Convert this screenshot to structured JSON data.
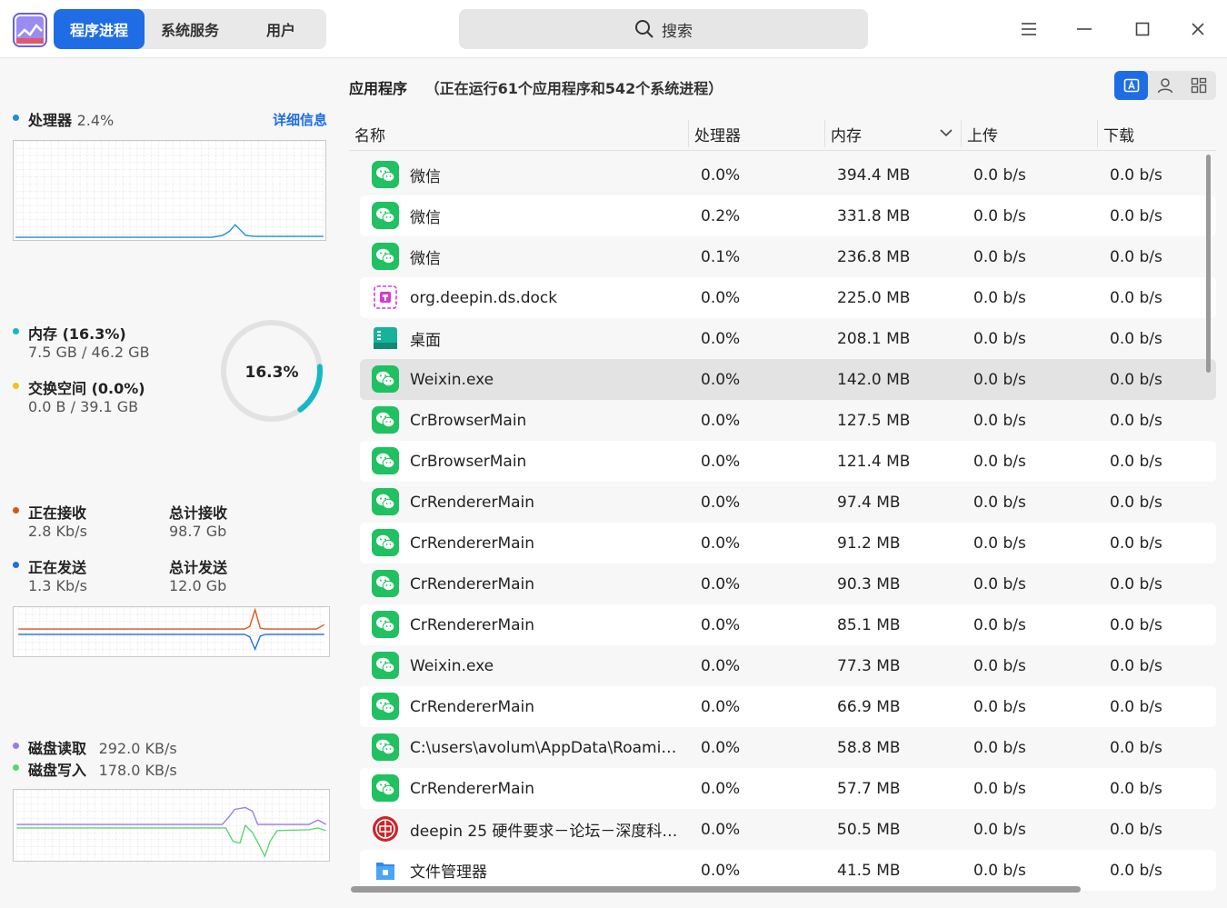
{
  "tabs": [
    {
      "label": "程序进程",
      "active": true
    },
    {
      "label": "系统服务",
      "active": false
    },
    {
      "label": "用户",
      "active": false
    }
  ],
  "search": {
    "placeholder": "搜索"
  },
  "colors": {
    "accent": "#1f6de5",
    "cpu": "#1a8fd6",
    "memory": "#16b8c4",
    "swap": "#f0c419",
    "receive": "#e0521a",
    "send": "#1f6de5",
    "disk_read": "#9a7be8",
    "disk_write": "#5cd66a"
  },
  "cpu": {
    "label": "处理器",
    "value": "2.4%",
    "detail_link": "详细信息"
  },
  "memory": {
    "label": "内存 (16.3%)",
    "usage": "7.5 GB / 46.2 GB",
    "swap_label": "交换空间 (0.0%)",
    "swap_usage": "0.0 B / 39.1 GB",
    "percent_text": "16.3%",
    "percent": 16.3
  },
  "network": {
    "receiving_label": "正在接收",
    "receiving_value": "2.8 Kb/s",
    "total_received_label": "总计接收",
    "total_received_value": "98.7 Gb",
    "sending_label": "正在发送",
    "sending_value": "1.3 Kb/s",
    "total_sent_label": "总计发送",
    "total_sent_value": "12.0 Gb"
  },
  "disk": {
    "read_label": "磁盘读取",
    "read_value": "292.0 KB/s",
    "write_label": "磁盘写入",
    "write_value": "178.0 KB/s"
  },
  "process_panel": {
    "title": "应用程序",
    "subtitle": "（正在运行61个应用程序和542个系统进程）",
    "columns": [
      "名称",
      "处理器",
      "内存",
      "上传",
      "下载"
    ]
  },
  "processes": [
    {
      "icon": "wechat-icon",
      "name": "微信",
      "cpu": "0.0%",
      "memory": "394.4 MB",
      "upload": "0.0 b/s",
      "download": "0.0 b/s"
    },
    {
      "icon": "wechat-icon",
      "name": "微信",
      "cpu": "0.2%",
      "memory": "331.8 MB",
      "upload": "0.0 b/s",
      "download": "0.0 b/s"
    },
    {
      "icon": "wechat-icon",
      "name": "微信",
      "cpu": "0.1%",
      "memory": "236.8 MB",
      "upload": "0.0 b/s",
      "download": "0.0 b/s"
    },
    {
      "icon": "dock-icon",
      "name": "org.deepin.ds.dock",
      "cpu": "0.0%",
      "memory": "225.0 MB",
      "upload": "0.0 b/s",
      "download": "0.0 b/s"
    },
    {
      "icon": "desktop-icon",
      "name": "桌面",
      "cpu": "0.0%",
      "memory": "208.1 MB",
      "upload": "0.0 b/s",
      "download": "0.0 b/s"
    },
    {
      "icon": "wechat-icon",
      "name": "Weixin.exe",
      "cpu": "0.0%",
      "memory": "142.0 MB",
      "upload": "0.0 b/s",
      "download": "0.0 b/s"
    },
    {
      "icon": "wechat-icon",
      "name": "CrBrowserMain",
      "cpu": "0.0%",
      "memory": "127.5 MB",
      "upload": "0.0 b/s",
      "download": "0.0 b/s"
    },
    {
      "icon": "wechat-icon",
      "name": "CrBrowserMain",
      "cpu": "0.0%",
      "memory": "121.4 MB",
      "upload": "0.0 b/s",
      "download": "0.0 b/s"
    },
    {
      "icon": "wechat-icon",
      "name": "CrRendererMain",
      "cpu": "0.0%",
      "memory": "97.4 MB",
      "upload": "0.0 b/s",
      "download": "0.0 b/s"
    },
    {
      "icon": "wechat-icon",
      "name": "CrRendererMain",
      "cpu": "0.0%",
      "memory": "91.2 MB",
      "upload": "0.0 b/s",
      "download": "0.0 b/s"
    },
    {
      "icon": "wechat-icon",
      "name": "CrRendererMain",
      "cpu": "0.0%",
      "memory": "90.3 MB",
      "upload": "0.0 b/s",
      "download": "0.0 b/s"
    },
    {
      "icon": "wechat-icon",
      "name": "CrRendererMain",
      "cpu": "0.0%",
      "memory": "85.1 MB",
      "upload": "0.0 b/s",
      "download": "0.0 b/s"
    },
    {
      "icon": "wechat-icon",
      "name": "Weixin.exe",
      "cpu": "0.0%",
      "memory": "77.3 MB",
      "upload": "0.0 b/s",
      "download": "0.0 b/s"
    },
    {
      "icon": "wechat-icon",
      "name": "CrRendererMain",
      "cpu": "0.0%",
      "memory": "66.9 MB",
      "upload": "0.0 b/s",
      "download": "0.0 b/s"
    },
    {
      "icon": "wechat-icon",
      "name": "C:\\users\\avolum\\AppData\\Roami…",
      "cpu": "0.0%",
      "memory": "58.8 MB",
      "upload": "0.0 b/s",
      "download": "0.0 b/s"
    },
    {
      "icon": "wechat-icon",
      "name": "CrRendererMain",
      "cpu": "0.0%",
      "memory": "57.7 MB",
      "upload": "0.0 b/s",
      "download": "0.0 b/s"
    },
    {
      "icon": "browser-red-icon",
      "name": "deepin 25 硬件要求－论坛－深度科…",
      "cpu": "0.0%",
      "memory": "50.5 MB",
      "upload": "0.0 b/s",
      "download": "0.0 b/s"
    },
    {
      "icon": "file-manager-icon",
      "name": "文件管理器",
      "cpu": "0.0%",
      "memory": "41.5 MB",
      "upload": "0.0 b/s",
      "download": "0.0 b/s"
    }
  ]
}
